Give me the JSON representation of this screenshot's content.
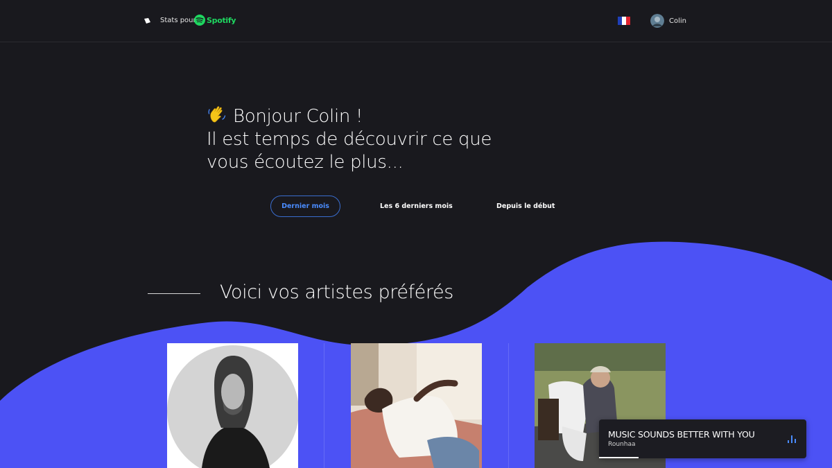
{
  "header": {
    "brand_text": "Stats pour",
    "spotify_word": "Spotify",
    "user_name": "Colin",
    "flag_colors": [
      "#1f3fb8",
      "#ffffff",
      "#e0232f"
    ]
  },
  "greeting": {
    "emoji_name": "waving-hand-icon",
    "line1": "Bonjour Colin !",
    "line2": "Il est temps de découvrir ce que",
    "line3": "vous écoutez le plus..."
  },
  "periods": {
    "active": "Dernier mois",
    "six_months": "Les 6 derniers mois",
    "all_time": "Depuis le début"
  },
  "section": {
    "title": "Voici vos artistes préférés"
  },
  "player": {
    "title": "MUSIC SOUNDS BETTER WITH YOU",
    "artist": "Rounhaa",
    "progress": 0.19
  },
  "colors": {
    "background": "#19191e",
    "wave": "#4c52f5",
    "accent": "#4a8cff",
    "spotify_green": "#1ed760"
  }
}
